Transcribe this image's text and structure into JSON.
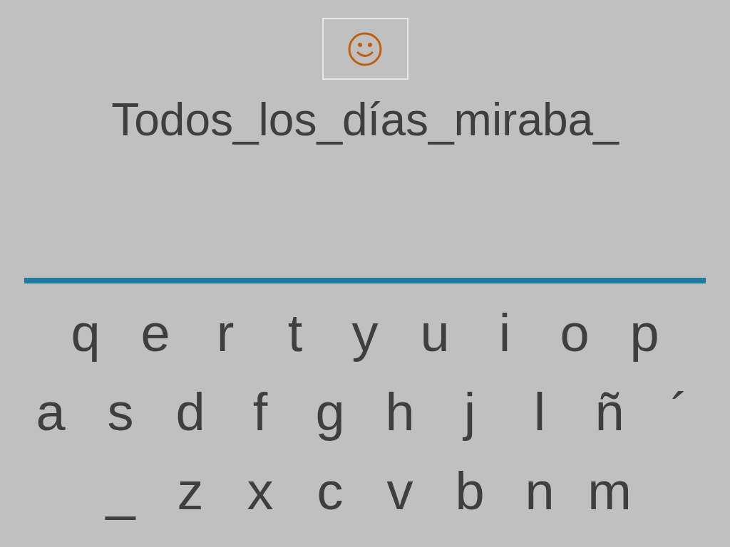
{
  "sentence": "Todos_los_días_miraba_",
  "keyboard": [
    [
      "q",
      "e",
      "r",
      "t",
      "y",
      "u",
      "i",
      "o",
      "p"
    ],
    [
      "a",
      "s",
      "d",
      "f",
      "g",
      "h",
      "j",
      "l",
      "ñ",
      "´"
    ],
    [
      "_",
      "z",
      "x",
      "c",
      "v",
      "b",
      "n",
      "m"
    ]
  ]
}
